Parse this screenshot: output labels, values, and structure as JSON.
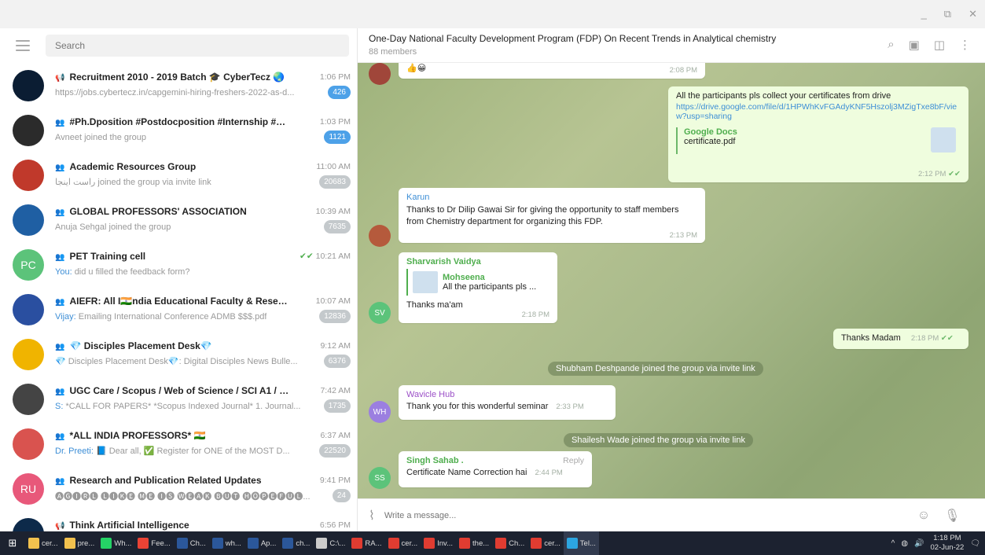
{
  "window": {
    "minimize": "_",
    "restore": "⧉",
    "close": "✕"
  },
  "sidebar": {
    "search_placeholder": "Search",
    "chats": [
      {
        "name": "Recruitment 2010 - 2019 Batch 🎓 CyberTecz 🌏",
        "type_icon": "📢",
        "time": "1:06 PM",
        "preview": "https://jobs.cybertecz.in/capgemini-hiring-freshers-2022-as-d...",
        "sender": "",
        "badge": "426",
        "badge_active": true,
        "avatar_color": "#0b1d33",
        "avatar_text": ""
      },
      {
        "name": "#Ph.Dposition #Postdocposition #Internship #Projec...",
        "type_icon": "👥",
        "time": "1:03 PM",
        "preview": "Avneet joined the group",
        "sender": "",
        "badge": "1121",
        "badge_active": true,
        "avatar_color": "#2b2b2b",
        "avatar_text": ""
      },
      {
        "name": "Academic Resources Group",
        "type_icon": "👥",
        "time": "11:00 AM",
        "preview": "ﺭﺍﺳﺖ ﺍﯾﻨﺠﺎ joined the group via invite link",
        "sender": "",
        "badge": "20683",
        "badge_active": false,
        "avatar_color": "#c0392b",
        "avatar_text": ""
      },
      {
        "name": "GLOBAL PROFESSORS' ASSOCIATION",
        "type_icon": "👥",
        "time": "10:39 AM",
        "preview": "Anuja Sehgal joined the group",
        "sender": "",
        "badge": "7635",
        "badge_active": false,
        "avatar_color": "#1f5fa3",
        "avatar_text": ""
      },
      {
        "name": "PET Training cell",
        "type_icon": "👥",
        "time": "10:21 AM",
        "preview": "did u filled the feedback form?",
        "sender": "You:",
        "badge": "",
        "badge_active": false,
        "avatar_color": "#5cc37a",
        "avatar_text": "PC",
        "check": "✔✔"
      },
      {
        "name": "AIEFR: All I🇮🇳ndia Educational Faculty & Research ...",
        "type_icon": "👥",
        "time": "10:07 AM",
        "preview": "Emailing International Conference ADMB $$$.pdf",
        "sender": "Vijay:",
        "badge": "12836",
        "badge_active": false,
        "avatar_color": "#2a4fa0",
        "avatar_text": ""
      },
      {
        "name": "💎 Disciples Placement Desk💎",
        "type_icon": "👥",
        "time": "9:12 AM",
        "preview": "💎 Disciples Placement Desk💎: Digital Disciples News Bulle...",
        "sender": "",
        "badge": "6376",
        "badge_active": false,
        "avatar_color": "#f0b400",
        "avatar_text": ""
      },
      {
        "name": "UGC Care / Scopus / Web of Science / SCI A1 / Semina...",
        "type_icon": "👥",
        "time": "7:42 AM",
        "preview": "*CALL FOR PAPERS* *Scopus Indexed Journal* 1. Journal...",
        "sender": "S:",
        "badge": "1735",
        "badge_active": false,
        "avatar_color": "#444",
        "avatar_text": ""
      },
      {
        "name": "*ALL INDIA PROFESSORS* 🇮🇳",
        "type_icon": "👥",
        "time": "6:37 AM",
        "preview": "📘 Dear all, ✅ Register for ONE of the MOST D...",
        "sender": "Dr. Preeti:",
        "badge": "22520",
        "badge_active": false,
        "avatar_color": "#d9534f",
        "avatar_text": ""
      },
      {
        "name": "Research and Publication Related Updates",
        "type_icon": "👥",
        "time": "9:41 PM",
        "preview": "🅐🅖🅘🅡🅛 🅛🅘🅚🅔 🅜🅔 🅘🅢 🅦🅔🅐🅚 🅑🅤🅣 🅗🅞🅟🅔🅕🅤🅛...",
        "sender": "",
        "badge": "24",
        "badge_active": false,
        "avatar_color": "#e8587a",
        "avatar_text": "RU"
      },
      {
        "name": "Think Artificial Intelligence",
        "type_icon": "📢",
        "time": "6:56 PM",
        "preview": "",
        "sender": "",
        "badge": "",
        "badge_active": false,
        "avatar_color": "#0d2a4a",
        "avatar_text": ""
      }
    ]
  },
  "chat": {
    "title": "One-Day National Faculty Development Program (FDP) On Recent Trends in Analytical chemistry",
    "members": "88 members",
    "messages": {
      "m0": {
        "text": "👍😀",
        "time": "2:08 PM"
      },
      "m1": {
        "text": "All the participants pls collect your certificates from drive",
        "link": "https://drive.google.com/file/d/1HPWhKvFGAdyKNF5Hszolj3MZigTxe8bF/view?usp=sharing",
        "preview_site": "Google Docs",
        "preview_title": "certificate.pdf",
        "time": "2:12 PM",
        "check": "✔✔"
      },
      "m2": {
        "author": "Karun",
        "text": "Thanks to Dr Dilip Gawai Sir for giving the opportunity to staff members from Chemistry department for organizing this FDP.",
        "time": "2:13 PM"
      },
      "m3": {
        "author": "Sharvarish Vaidya",
        "reply_name": "Mohseena",
        "reply_text": "All the participants pls ...",
        "text": "Thanks ma'am",
        "time": "2:18 PM",
        "avatar": "SV"
      },
      "m4": {
        "text": "Thanks Madam",
        "time": "2:18 PM",
        "check": "✔✔"
      },
      "s1": "Shubham Deshpande joined the group via invite link",
      "m5": {
        "author": "Wavicle Hub",
        "text": "Thank you for this wonderful seminar",
        "time": "2:33 PM",
        "avatar": "WH"
      },
      "s2": "Shailesh Wade joined the group via invite link",
      "m6": {
        "author": "Singh Sahab .",
        "reply_label": "Reply",
        "text": "Certificate Name Correction hai",
        "time": "2:44 PM",
        "avatar": "SS"
      }
    },
    "composer_placeholder": "Write a message..."
  },
  "taskbar": {
    "apps": [
      {
        "label": "cer...",
        "color": "#f2c14e"
      },
      {
        "label": "pre...",
        "color": "#f2c14e"
      },
      {
        "label": "Wh...",
        "color": "#25d366"
      },
      {
        "label": "Fee...",
        "color": "#ea4335"
      },
      {
        "label": "Ch...",
        "color": "#2b579a"
      },
      {
        "label": "wh...",
        "color": "#2b579a"
      },
      {
        "label": "Ap...",
        "color": "#2b579a"
      },
      {
        "label": "ch...",
        "color": "#2b579a"
      },
      {
        "label": "C:\\...",
        "color": "#cccccc"
      },
      {
        "label": "RA...",
        "color": "#e03c31"
      },
      {
        "label": "cer...",
        "color": "#e03c31"
      },
      {
        "label": "Inv...",
        "color": "#e03c31"
      },
      {
        "label": "the...",
        "color": "#e03c31"
      },
      {
        "label": "Ch...",
        "color": "#e03c31"
      },
      {
        "label": "cer...",
        "color": "#e03c31"
      },
      {
        "label": "Tel...",
        "color": "#2ca5e0"
      }
    ],
    "time": "1:18 PM",
    "date": "02-Jun-22"
  }
}
